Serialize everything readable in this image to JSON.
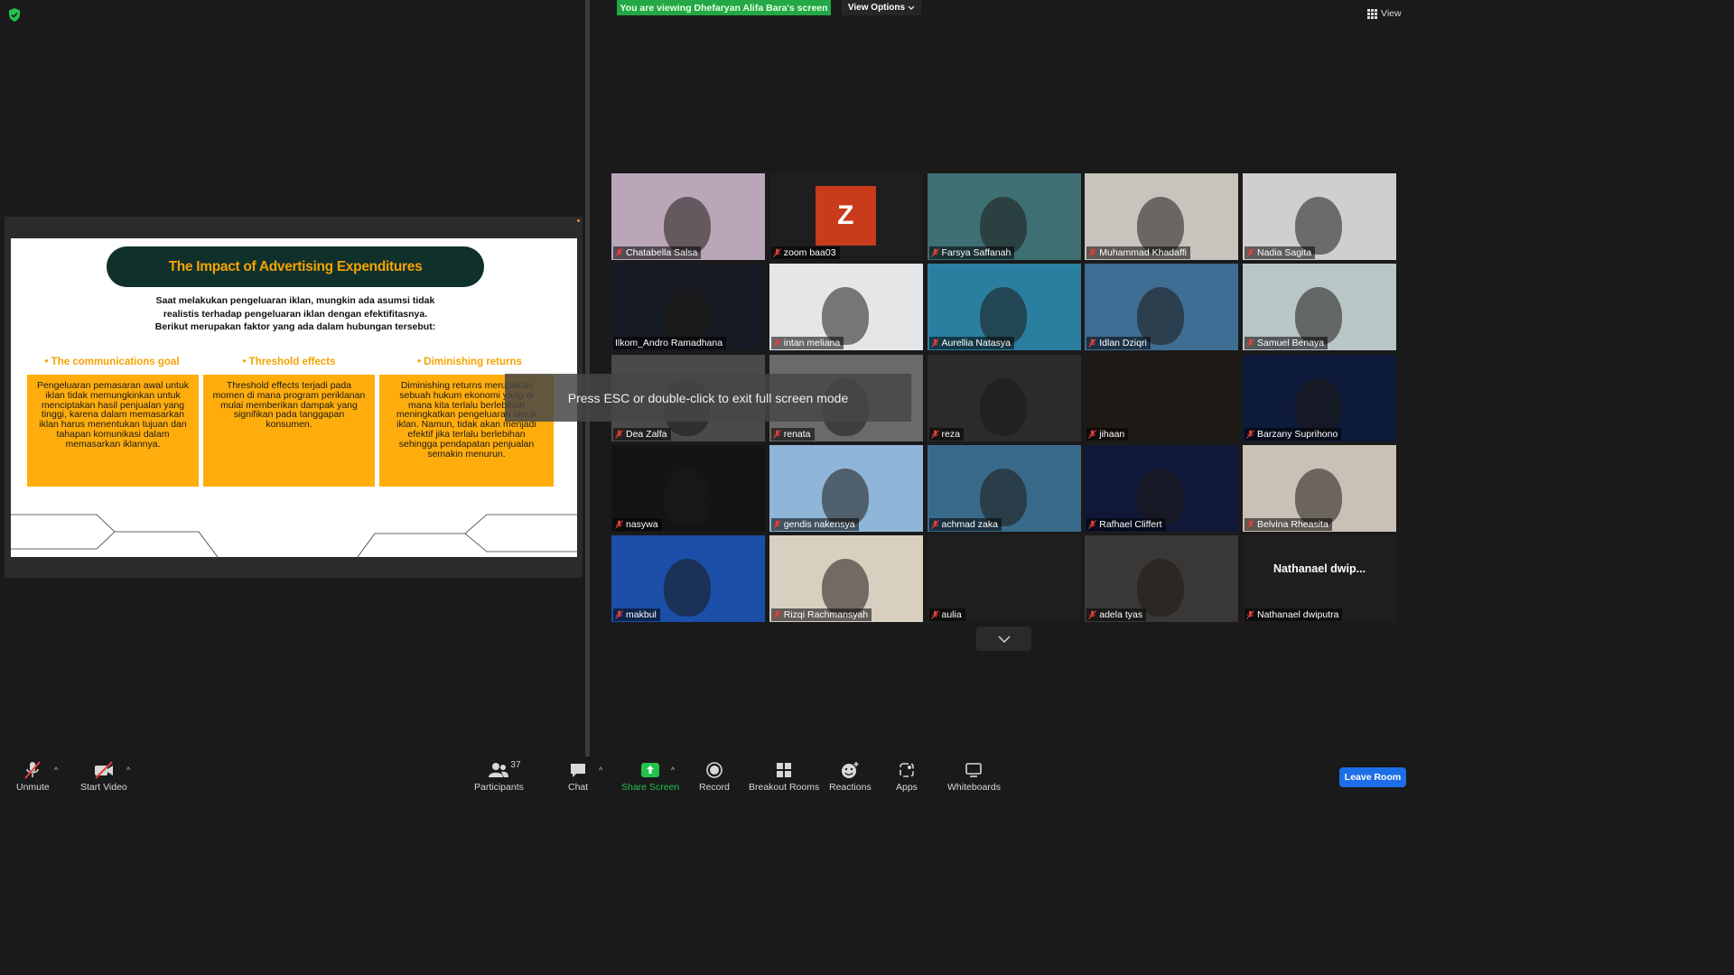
{
  "screen_share": {
    "viewing_banner": "You are viewing Dhefaryan Alifa Bara's screen",
    "view_options_label": "View Options",
    "view_label": "View"
  },
  "slide": {
    "title": "The Impact of Advertising Expenditures",
    "intro": "Saat melakukan pengeluaran iklan, mungkin ada asumsi tidak realistis terhadap pengeluaran iklan dengan efektifitasnya. Berikut merupakan faktor yang ada dalam hubungan tersebut:",
    "columns": [
      {
        "heading": "• The communications goal",
        "body": "Pengeluaran pemasaran awal untuk iklan tidak memungkinkan untuk menciptakan hasil penjualan yang tinggi, karena dalam memasarkan iklan harus menentukan tujuan dan tahapan komunikasi dalam memasarkan iklannya."
      },
      {
        "heading": "• Threshold effects",
        "body": "Threshold effects terjadi pada momen di mana program periklanan mulai memberikan dampak yang signifikan pada tanggapan konsumen."
      },
      {
        "heading": "• Diminishing returns",
        "body": "Diminishing returns merupakan sebuah hukum ekonomi yang di mana kita terlalu berlebihan meningkatkan pengeluaran untuk iklan. Namun, tidak akan menjadi efektif jika terlalu berlebihan sehingga pendapatan penjualan semakin menurun."
      }
    ]
  },
  "overlay": {
    "esc_message": "Press ESC or double-click to exit full screen mode"
  },
  "gallery": {
    "participants": [
      {
        "name": "Chatabella Salsa",
        "muted": true,
        "bg": "#b9a7b8",
        "video": true
      },
      {
        "name": "zoom baa03",
        "muted": true,
        "bg": "#1e1e1e",
        "avatar_letter": "Z"
      },
      {
        "name": "Farsya Saffanah",
        "muted": true,
        "bg": "#3d6f73",
        "video": true
      },
      {
        "name": "Muhammad Khadaffi",
        "muted": true,
        "bg": "#c9c3bd",
        "video": true
      },
      {
        "name": "Nadia Sagita",
        "muted": true,
        "bg": "#cfcfcf",
        "video": true
      },
      {
        "name": "Ilkom_Andro Ramadhana",
        "muted": false,
        "bg": "#161a22",
        "video": true,
        "active_speaker": true
      },
      {
        "name": "intan meliana",
        "muted": true,
        "bg": "#e4e6e8",
        "video": true
      },
      {
        "name": "Aurellia Natasya",
        "muted": true,
        "bg": "#2a7fa0",
        "video": true
      },
      {
        "name": "Idlan Dziqri",
        "muted": true,
        "bg": "#3f6e94",
        "video": true
      },
      {
        "name": "Samuel Benaya",
        "muted": true,
        "bg": "#b8c6c8",
        "video": true
      },
      {
        "name": "Dea Zalfa",
        "muted": true,
        "bg": "#4a4a4a",
        "video": true
      },
      {
        "name": "renata",
        "muted": true,
        "bg": "#6a6a6a",
        "video": true
      },
      {
        "name": "reza",
        "muted": true,
        "bg": "#2b2b2b",
        "video": true
      },
      {
        "name": "jihaan",
        "muted": true,
        "bg": "#1f1a16",
        "video": true
      },
      {
        "name": "Barzany Suprihono",
        "muted": true,
        "bg": "#0d1a3a",
        "video": true
      },
      {
        "name": "nasywa",
        "muted": true,
        "bg": "#141414",
        "video": true
      },
      {
        "name": "gendis nakensya",
        "muted": true,
        "bg": "#8fb6d8",
        "video": true
      },
      {
        "name": "achmad zaka",
        "muted": true,
        "bg": "#3a6a8a",
        "video": true
      },
      {
        "name": "Rafhael Cliffert",
        "muted": true,
        "bg": "#10183a",
        "video": true
      },
      {
        "name": "Belvina Rheasita",
        "muted": true,
        "bg": "#c9c0b6",
        "video": true
      },
      {
        "name": "makbul",
        "muted": true,
        "bg": "#1b4fa8",
        "video": true
      },
      {
        "name": "Rizqi Rachmansyah",
        "muted": true,
        "bg": "#d9cfc0",
        "video": true
      },
      {
        "name": "aulia",
        "muted": true,
        "bg": "#1e1e1e",
        "video": false
      },
      {
        "name": "adela tyas",
        "muted": true,
        "bg": "#3a3836",
        "video": true
      },
      {
        "name": "Nathanael dwiputra",
        "muted": true,
        "bg": "#1e1e1e",
        "video": false,
        "display_name_short": "Nathanael  dwip..."
      }
    ]
  },
  "toolbar": {
    "unmute": "Unmute",
    "start_video": "Start Video",
    "participants": "Participants",
    "participants_count": "37",
    "chat": "Chat",
    "share_screen": "Share Screen",
    "record": "Record",
    "breakout_rooms": "Breakout Rooms",
    "reactions": "Reactions",
    "apps": "Apps",
    "whiteboards": "Whiteboards",
    "leave_room": "Leave Room"
  },
  "colors": {
    "share_green": "#23a845",
    "leave_blue": "#1c6fe8",
    "slide_orange": "#ffad0d",
    "slide_title_bg": "#10302c",
    "active_speaker": "#c3e34a",
    "mute_red": "#e0403a"
  }
}
